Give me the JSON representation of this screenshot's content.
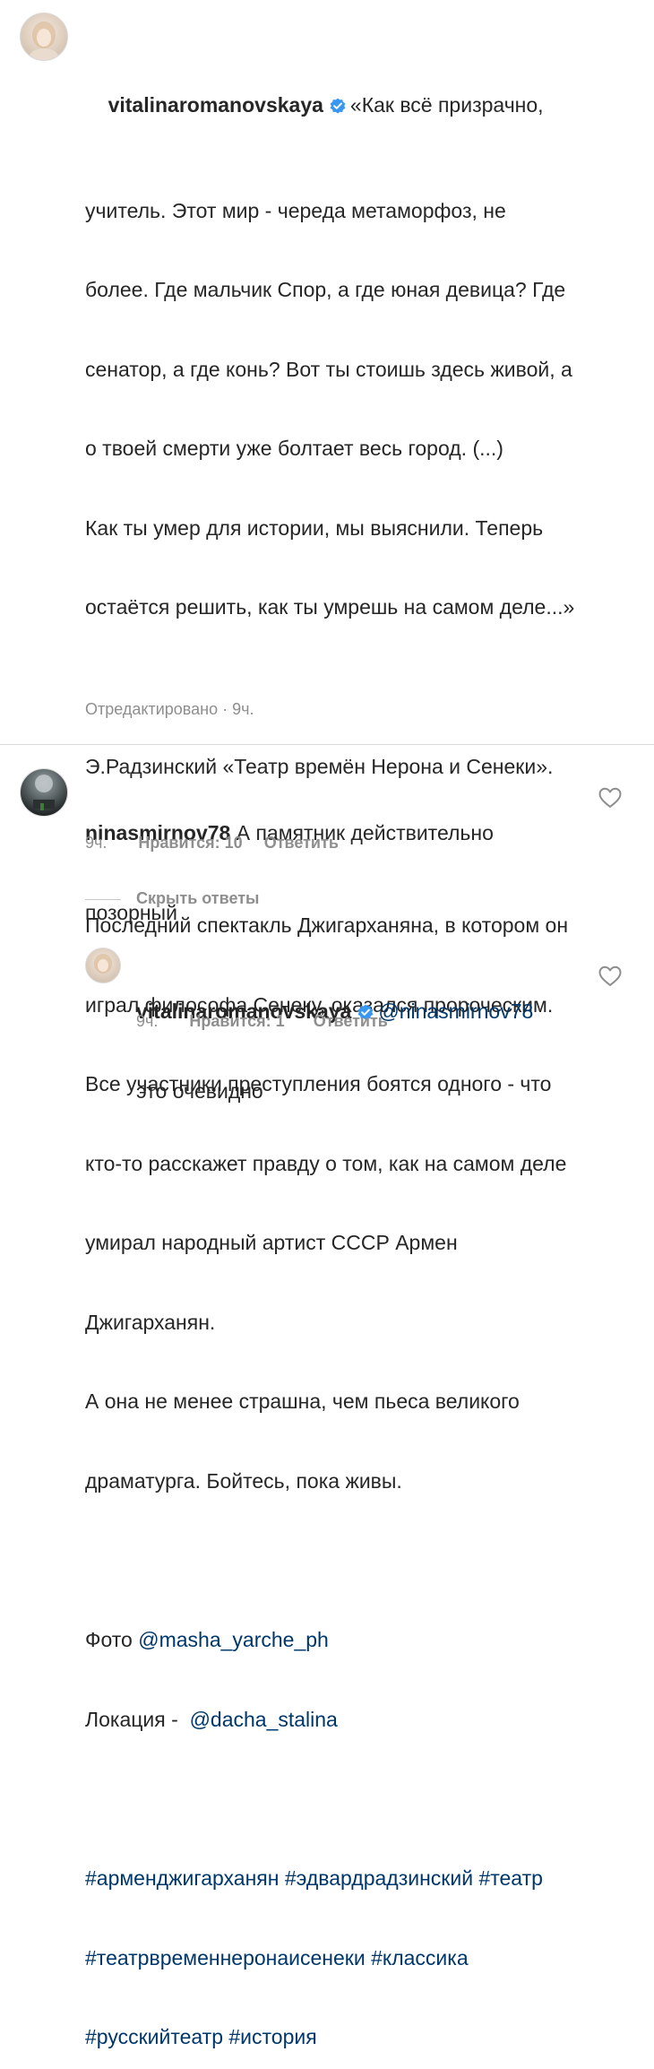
{
  "post": {
    "username": "vitalinaromanovskaya",
    "quote_lines": [
      "«Как всё призрачно,",
      "учитель. Этот мир - череда метаморфоз, не",
      "более. Где мальчик Спор, а где юная девица? Где",
      "сенатор, а где конь? Вот ты стоишь здесь живой, а",
      "о твоей смерти уже болтает весь город. (...)",
      "Как ты умер для истории, мы выяснили. Теперь",
      "остаётся решить, как ты умрешь на самом деле...»"
    ],
    "source": "Э.Радзинский «Театр времён Нерона и Сенеки».",
    "body_lines": [
      "Последний спектакль Джигарханяна, в котором он",
      "играл философа Сенеку, оказался пророческим.",
      "Все участники преступления боятся одного - что",
      "кто-то расскажет правду о том, как на самом деле",
      "умирал народный артист СССР Армен",
      "Джигарханян.",
      "А она не менее страшна, чем пьеса великого",
      "драматурга. Бойтесь, пока живы."
    ],
    "photo_label": "Фото ",
    "photo_mention": "@masha_yarche_ph",
    "location_label": "Локация -  ",
    "location_mention": "@dacha_stalina",
    "hashtag_lines": [
      "#арменджигарханян #эдвардрадзинский #театр",
      "#театрвременнеронаисенеки #классика",
      "#русскийтеатр #история"
    ],
    "edited": "Отредактировано · 9ч."
  },
  "comments": [
    {
      "username": "ninasmirnov78",
      "text_line1": "А памятник действительно",
      "text_line2": "позорный",
      "time": "9ч.",
      "likes": "Нравится: 10",
      "reply": "Ответить"
    }
  ],
  "hide_replies": "Скрыть ответы",
  "reply_comment": {
    "username": "vitalinaromanovskaya",
    "mention": "@ninasmirnov78",
    "text": "это очевидно",
    "time": "9ч.",
    "likes": "Нравится: 1",
    "reply": "Ответить"
  },
  "colors": {
    "text": "#262626",
    "link": "#00376b",
    "meta": "#8e8e8e",
    "verified": "#3897f0"
  }
}
